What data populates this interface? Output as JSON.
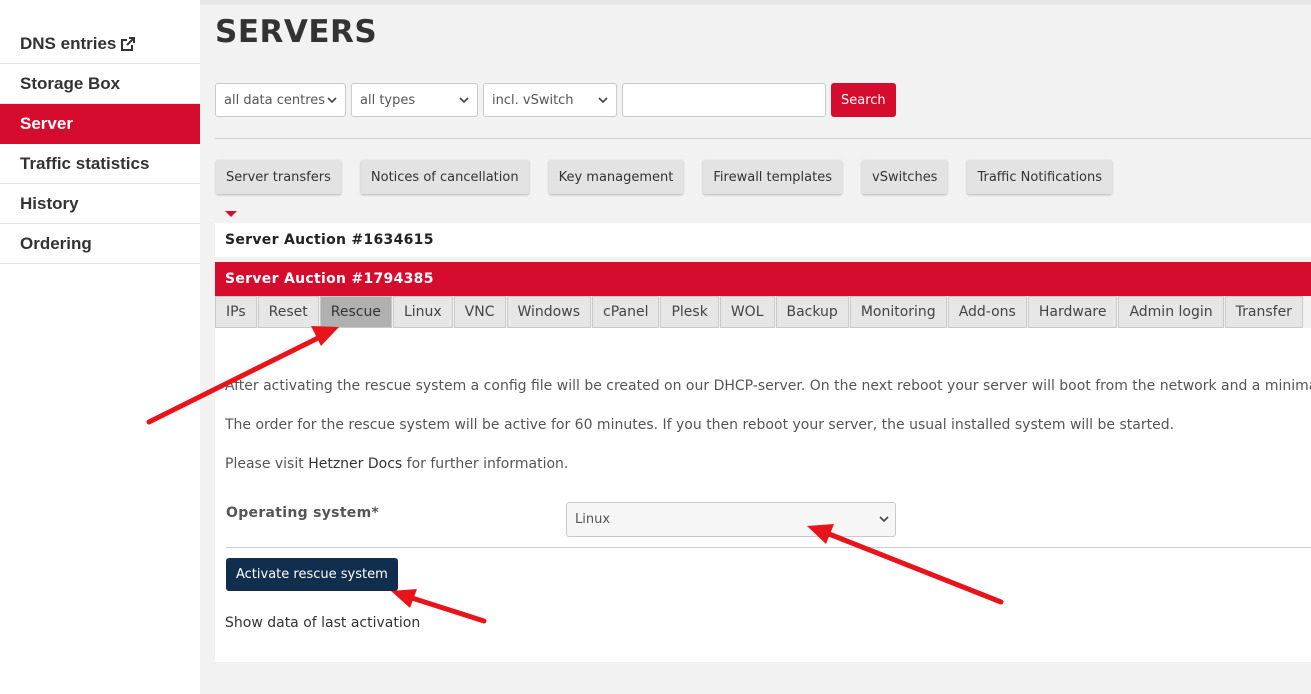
{
  "sidebar": {
    "items": [
      {
        "label": "DNS entries"
      },
      {
        "label": "Storage Box"
      },
      {
        "label": "Server"
      },
      {
        "label": "Traffic statistics"
      },
      {
        "label": "History"
      },
      {
        "label": "Ordering"
      }
    ],
    "active": "Server"
  },
  "page": {
    "title": "SERVERS"
  },
  "filters": {
    "datacentre": "all data centres",
    "type": "all types",
    "vswitch": "incl. vSwitch",
    "search_value": "",
    "search_button": "Search"
  },
  "quick_links": [
    "Server transfers",
    "Notices of cancellation",
    "Key management",
    "Firewall templates",
    "vSwitches",
    "Traffic Notifications"
  ],
  "servers": [
    {
      "name": "Server Auction #1634615"
    },
    {
      "name": "Server Auction #1794385"
    }
  ],
  "tabs": [
    "IPs",
    "Reset",
    "Rescue",
    "Linux",
    "VNC",
    "Windows",
    "cPanel",
    "Plesk",
    "WOL",
    "Backup",
    "Monitoring",
    "Add-ons",
    "Hardware",
    "Admin login",
    "Transfer"
  ],
  "active_tab": "Rescue",
  "rescue": {
    "para1": "After activating the rescue system a config file will be created on our DHCP-server. On the next reboot your server will boot from the network and a minimal",
    "para2": "The order for the rescue system will be active for 60 minutes. If you then reboot your server, the usual installed system will be started.",
    "para3_prefix": "Please visit ",
    "para3_link": "Hetzner Docs",
    "para3_suffix": " for further information.",
    "os_label": "Operating system*",
    "os_value": "Linux",
    "activate_button": "Activate rescue system",
    "show_data_link": "Show data of last activation"
  },
  "colors": {
    "brand_red": "#d50c2d",
    "activate_button": "#112e4e",
    "annotation_arrow": "#e8141b"
  },
  "icons": {
    "external_link": "external-link-icon",
    "dropdown": "chevron-down-icon",
    "section_marker": "caret-down-icon"
  }
}
